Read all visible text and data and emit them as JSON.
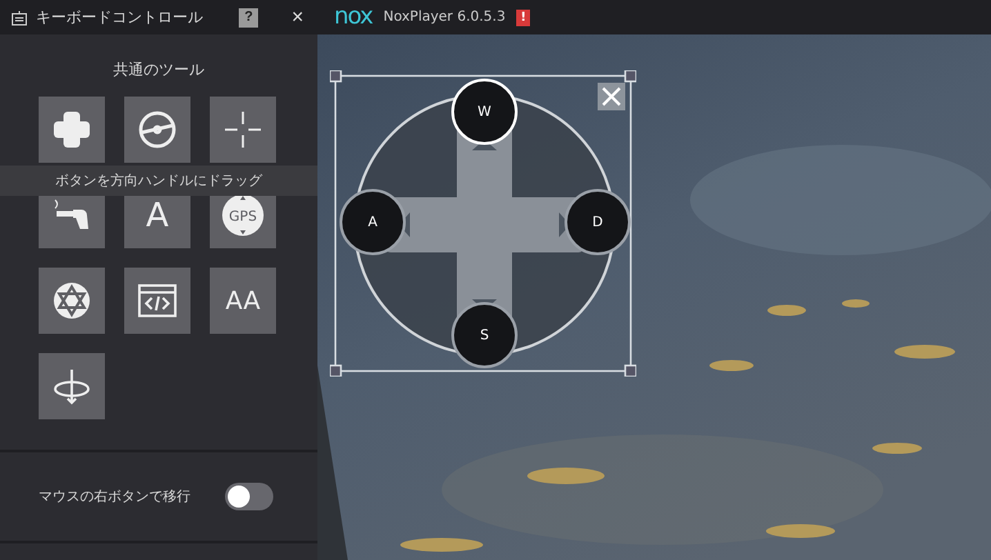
{
  "panel": {
    "title": "キーボードコントロール",
    "help": "?",
    "close": "×"
  },
  "tools": {
    "heading": "共通のツール",
    "tooltip": "ボタンを方向ハンドルにドラッグ",
    "items": [
      {
        "kind": "dpad"
      },
      {
        "kind": "wheel"
      },
      {
        "kind": "crosshair"
      },
      {
        "kind": "gun"
      },
      {
        "kind": "letter",
        "label": "A"
      },
      {
        "kind": "gps",
        "label": "GPS"
      },
      {
        "kind": "star"
      },
      {
        "kind": "code"
      },
      {
        "kind": "letter",
        "label": "AA"
      },
      {
        "kind": "rotate"
      }
    ]
  },
  "option": {
    "label": "マウスの右ボタンで移行",
    "on": false
  },
  "player": {
    "logo": "nox",
    "title": "NoxPlayer 6.0.5.3",
    "alert": "!"
  },
  "keymap": {
    "keys": [
      {
        "label": "W",
        "kind": "up"
      },
      {
        "label": "A",
        "kind": "left"
      },
      {
        "label": "D",
        "kind": "right"
      },
      {
        "label": "S",
        "kind": "down"
      }
    ]
  }
}
